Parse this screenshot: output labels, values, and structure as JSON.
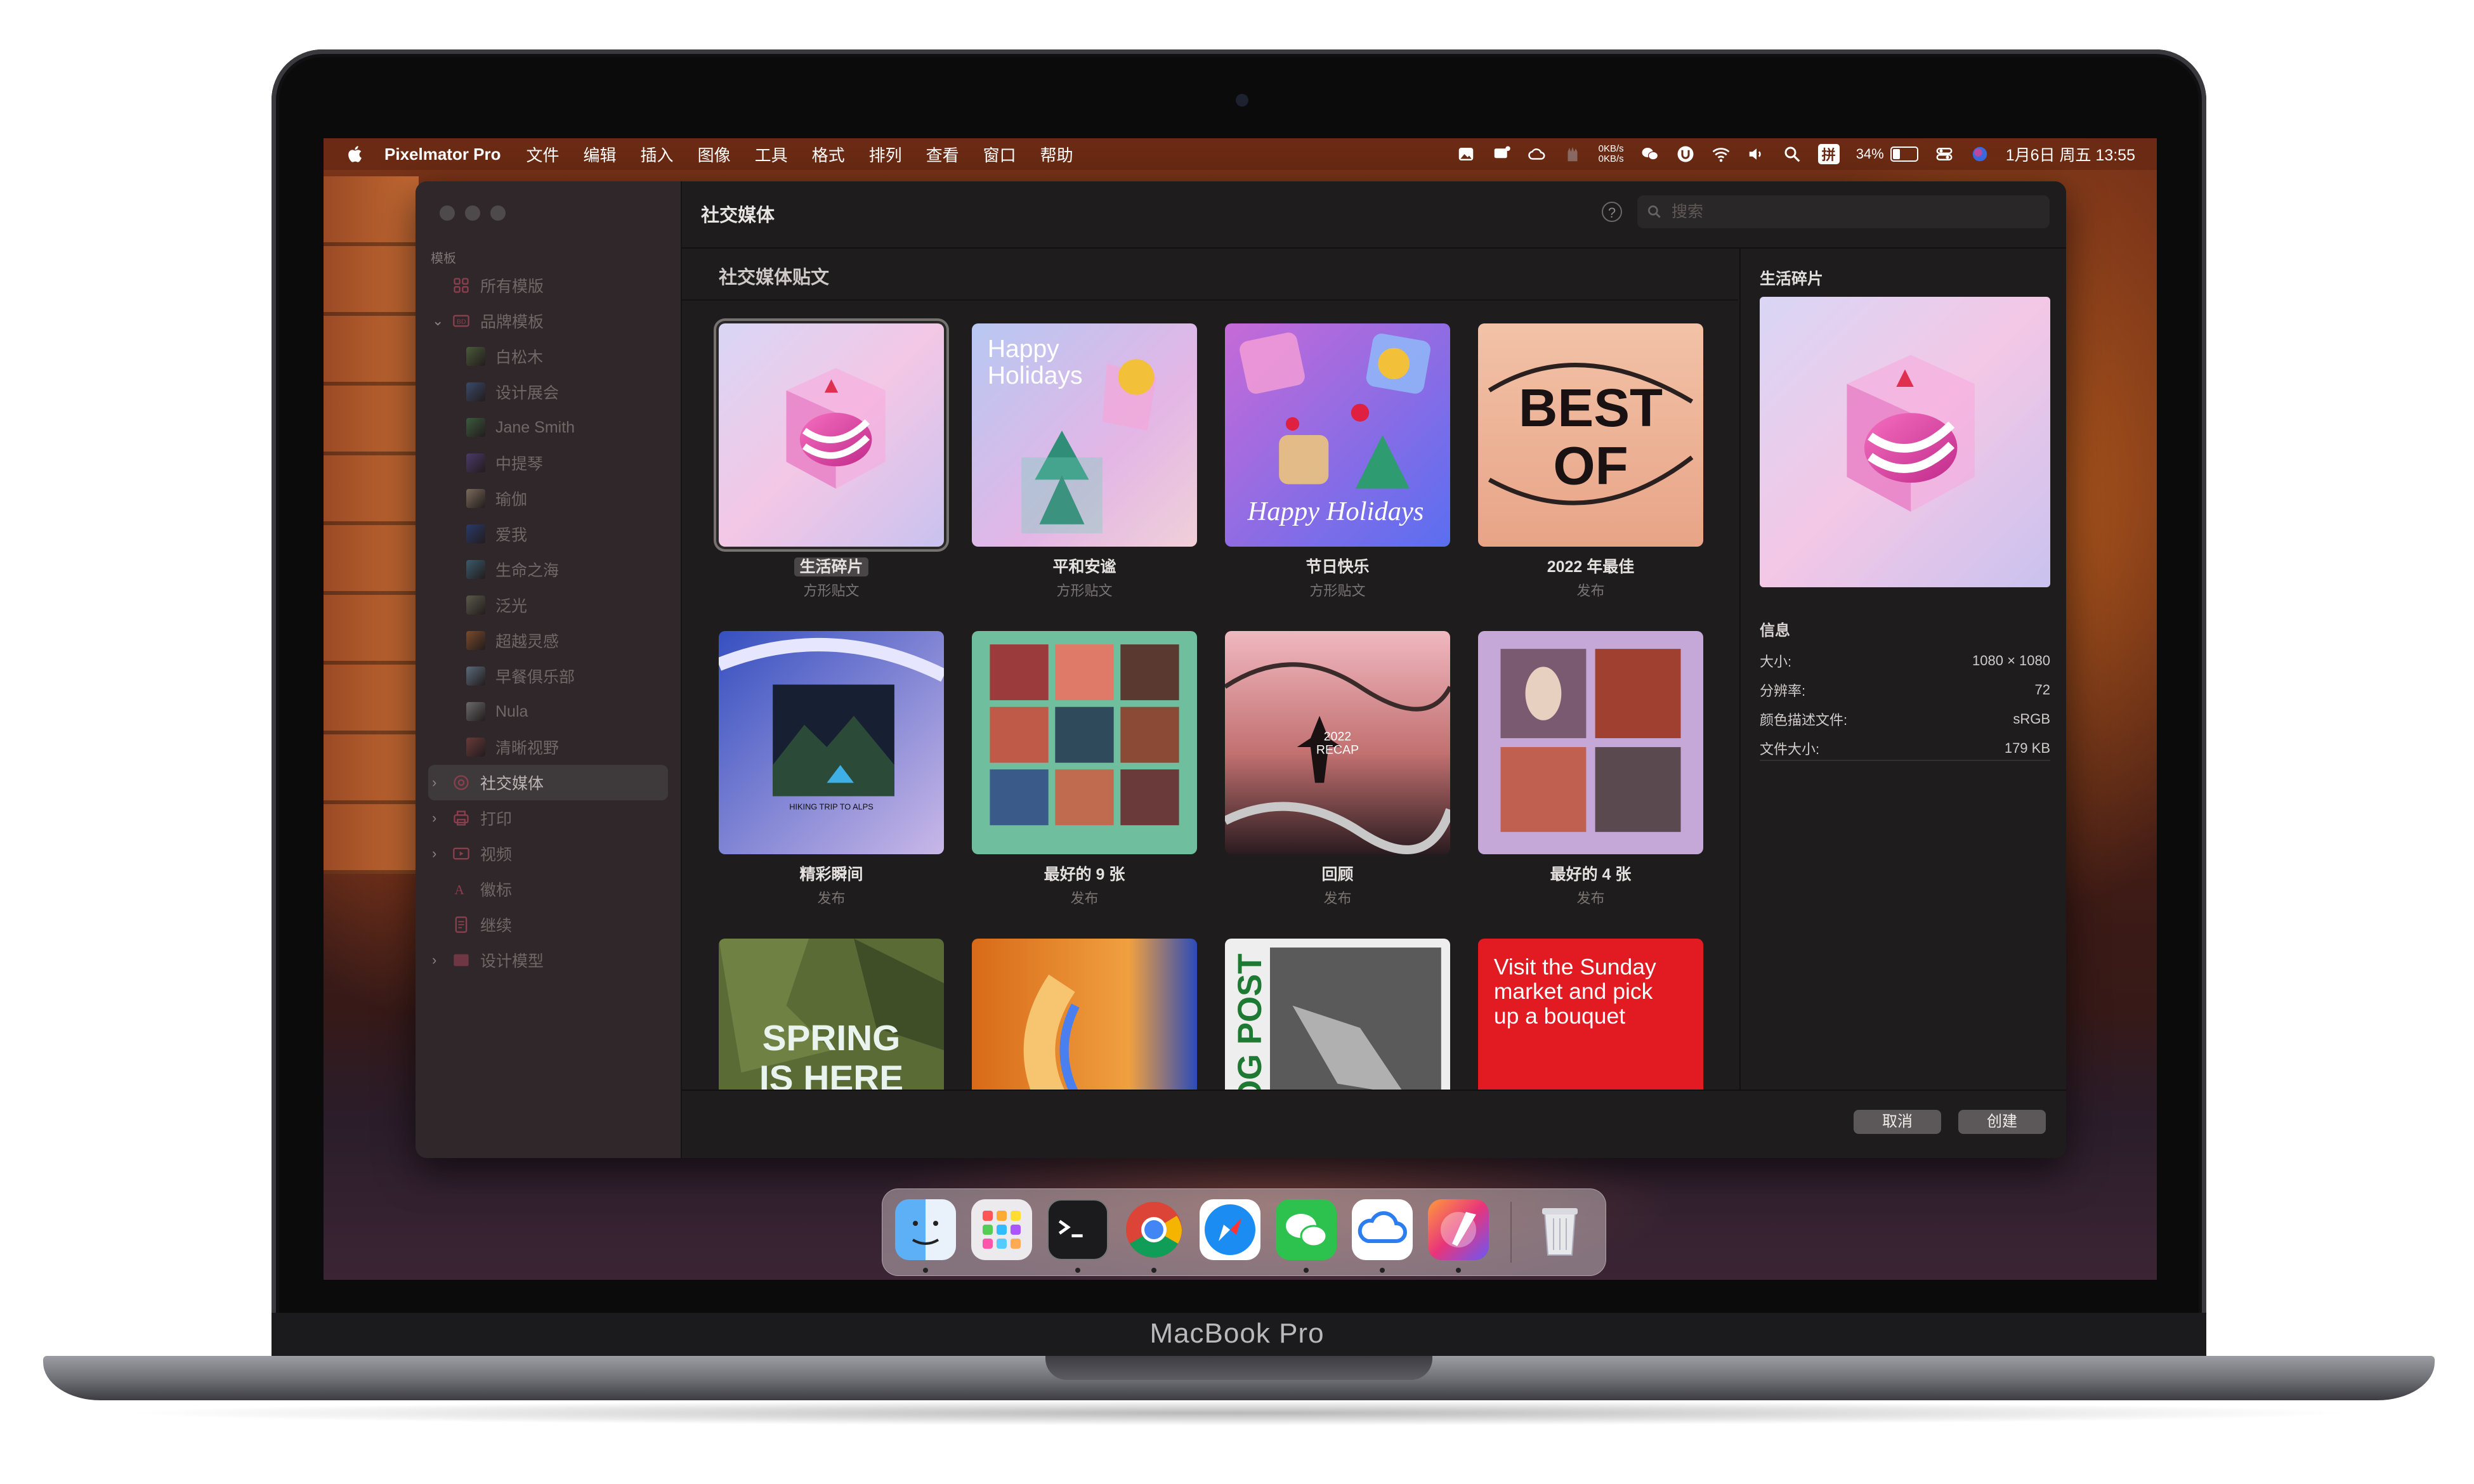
{
  "device": {
    "brand": "MacBook Pro"
  },
  "menubar": {
    "app_name": "Pixelmator Pro",
    "menus": [
      "文件",
      "编辑",
      "插入",
      "图像",
      "工具",
      "格式",
      "排列",
      "查看",
      "窗口",
      "帮助"
    ],
    "net_up": "0KB/s",
    "net_down": "0KB/s",
    "input_method": "拼",
    "battery_text": "34%",
    "battery_level": 0.34,
    "datetime": "1月6日 周五  13:55"
  },
  "window": {
    "title": "社交媒体",
    "search_placeholder": "搜索",
    "sidebar": {
      "section": "模板",
      "items": [
        {
          "label": "所有模版",
          "kind": "top",
          "icon": "grid-icon"
        },
        {
          "label": "品牌模板",
          "kind": "top",
          "icon": "brand-icon",
          "expanded": true
        },
        {
          "label": "白松木",
          "kind": "sub",
          "thumb": "#4a5a3a"
        },
        {
          "label": "设计展会",
          "kind": "sub",
          "thumb": "#3a4a6a"
        },
        {
          "label": "Jane Smith",
          "kind": "sub",
          "thumb": "#3c5a3c"
        },
        {
          "label": "中提琴",
          "kind": "sub",
          "thumb": "#4a3a6a"
        },
        {
          "label": "瑜伽",
          "kind": "sub",
          "thumb": "#7a6a5a"
        },
        {
          "label": "爱我",
          "kind": "sub",
          "thumb": "#2a3a6a"
        },
        {
          "label": "生命之海",
          "kind": "sub",
          "thumb": "#3a5a6a"
        },
        {
          "label": "泛光",
          "kind": "sub",
          "thumb": "#5a5a4a"
        },
        {
          "label": "超越灵感",
          "kind": "sub",
          "thumb": "#7a4a2a"
        },
        {
          "label": "早餐俱乐部",
          "kind": "sub",
          "thumb": "#5a6a7a"
        },
        {
          "label": "Nula",
          "kind": "sub",
          "thumb": "#6a6a6a"
        },
        {
          "label": "清晰视野",
          "kind": "sub",
          "thumb": "#6a3a3a"
        },
        {
          "label": "社交媒体",
          "kind": "top",
          "icon": "at-icon",
          "chevron": true,
          "selected": true
        },
        {
          "label": "打印",
          "kind": "top",
          "icon": "printer-icon",
          "chevron": true
        },
        {
          "label": "视频",
          "kind": "top",
          "icon": "video-icon",
          "chevron": true
        },
        {
          "label": "徽标",
          "kind": "top",
          "icon": "logo-icon"
        },
        {
          "label": "继续",
          "kind": "top",
          "icon": "document-icon"
        },
        {
          "label": "设计模型",
          "kind": "top",
          "icon": "mockup-icon",
          "chevron": true
        }
      ]
    },
    "gallery": {
      "heading": "社交媒体贴文",
      "templates": [
        {
          "name": "生活碎片",
          "type": "方形贴文",
          "selected": true,
          "art": "cube"
        },
        {
          "name": "平和安谧",
          "type": "方形贴文",
          "art": "holidays",
          "text": "Happy Holidays"
        },
        {
          "name": "节日快乐",
          "type": "方形贴文",
          "art": "festive",
          "text": "Happy Holidays"
        },
        {
          "name": "2022 年最佳",
          "type": "发布",
          "art": "bestof",
          "text": "BEST OF"
        },
        {
          "name": "精彩瞬间",
          "type": "发布",
          "art": "hiking",
          "text": "HIKING TRIP TO ALPS"
        },
        {
          "name": "最好的 9 张",
          "type": "发布",
          "art": "nine"
        },
        {
          "name": "回顾",
          "type": "发布",
          "art": "recap",
          "text": "2022 RECAP"
        },
        {
          "name": "最好的 4 张",
          "type": "发布",
          "art": "four"
        },
        {
          "name": "",
          "type": "",
          "art": "spring",
          "text": "SPRING IS HERE"
        },
        {
          "name": "",
          "type": "",
          "art": "orange"
        },
        {
          "name": "",
          "type": "",
          "art": "blog",
          "text": "BLOG POST"
        },
        {
          "name": "",
          "type": "",
          "art": "sunday",
          "text": "Visit the Sunday market and pick up a bouquet"
        }
      ]
    },
    "inspector": {
      "title": "生活碎片",
      "info_heading": "信息",
      "info": [
        {
          "key": "大小:",
          "value": "1080 × 1080"
        },
        {
          "key": "分辨率:",
          "value": "72"
        },
        {
          "key": "颜色描述文件:",
          "value": "sRGB"
        },
        {
          "key": "文件大小:",
          "value": "179 KB"
        }
      ]
    },
    "buttons": {
      "cancel": "取消",
      "create": "创建"
    }
  },
  "dock": {
    "apps": [
      "finder-icon",
      "launchpad-icon",
      "terminal-icon",
      "chrome-icon",
      "safari-icon",
      "wechat-icon",
      "icloud-drive-icon",
      "pixelmator-pro-icon"
    ],
    "trash": "trash-icon"
  },
  "colors": {
    "accent": "#e21a22",
    "window_bg": "#1e1c1d",
    "sidebar_bg": "#302829"
  }
}
